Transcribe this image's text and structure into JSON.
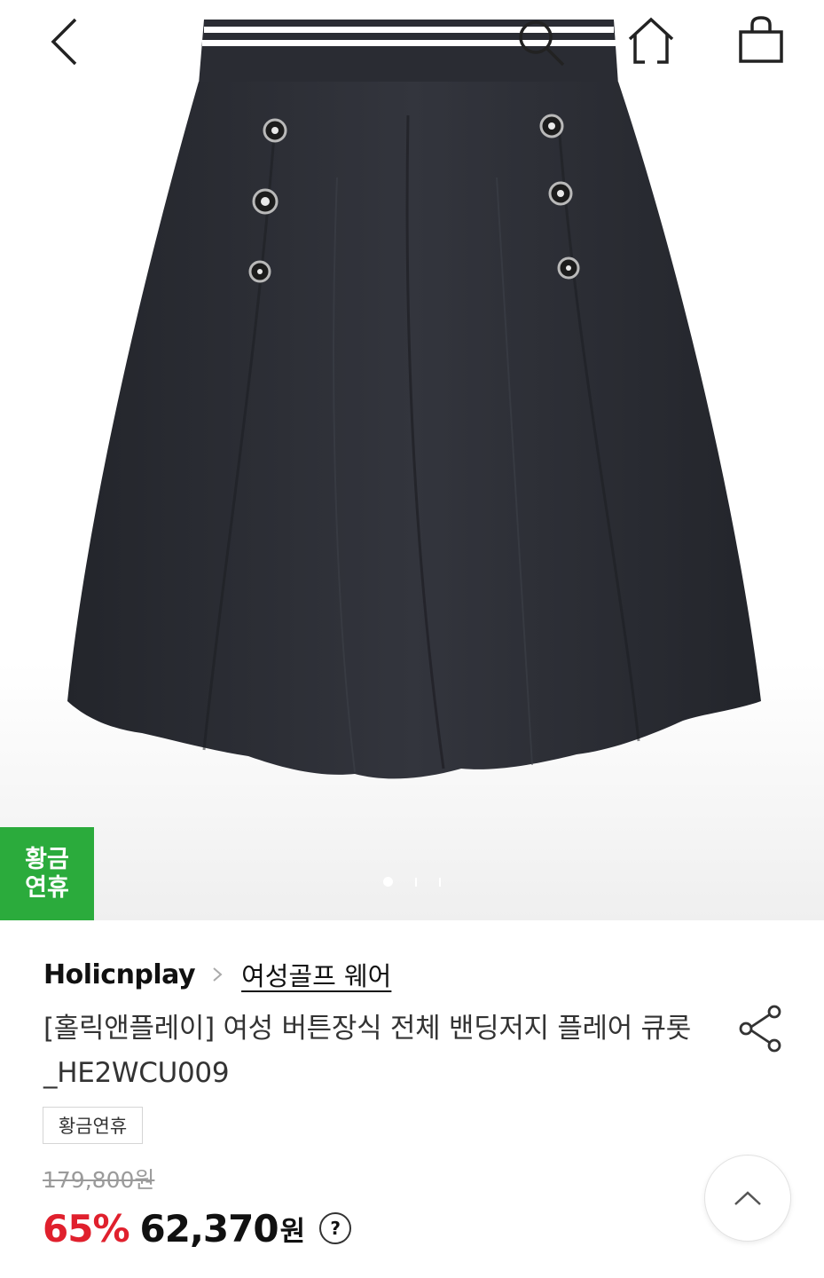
{
  "hero": {
    "badge_line1": "황금",
    "badge_line2": "연휴",
    "image_alt": "navy flare culotte skirt with striped waistband and buttons"
  },
  "header": {
    "icons": [
      "back-arrow-icon",
      "search-icon",
      "home-icon",
      "shopping-bag-icon"
    ]
  },
  "breadcrumb": {
    "brand": "Holicnplay",
    "category": "여성골프 웨어"
  },
  "product": {
    "title": "[홀릭앤플레이] 여성 버튼장식 전체 밴딩저지 플레어 큐롯_HE2WCU009",
    "tag": "황금연휴",
    "original_price": "179,800원",
    "discount": "65%",
    "price": "62,370",
    "currency": "원",
    "help": "?"
  },
  "colors": {
    "badge": "#2bab3c",
    "discount": "#e0202d",
    "skirt": "#2a2c33"
  }
}
